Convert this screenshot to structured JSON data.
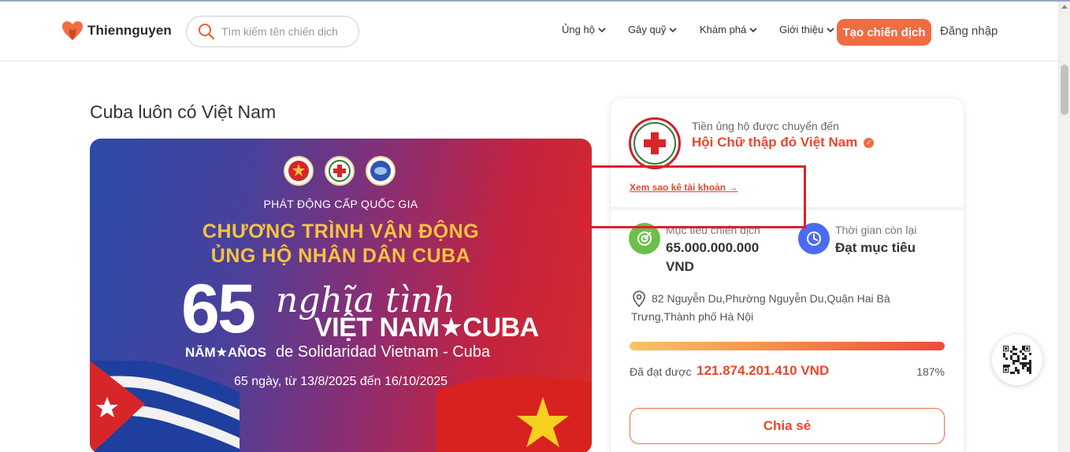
{
  "header": {
    "logo_text": "Thiennguyen",
    "search_placeholder": "Tìm kiếm tên chiến dịch",
    "nav": [
      {
        "label": "Ủng hộ"
      },
      {
        "label": "Gây quỹ"
      },
      {
        "label": "Khám phá"
      },
      {
        "label": "Giới thiệu"
      }
    ],
    "create_button": "Tạo chiến dịch",
    "login": "Đăng nhập"
  },
  "campaign": {
    "title": "Cuba luôn có Việt Nam",
    "banner": {
      "kicker": "PHÁT ĐỘNG CẤP QUỐC GIA",
      "headline_1": "CHƯƠNG TRÌNH VẬN ĐỘNG",
      "headline_2": "ỦNG HỘ NHÂN DÂN CUBA",
      "number": "65",
      "years": "NĂM★AÑOS",
      "script_text": "nghĩa tình",
      "countries": "VIỆT NAM★CUBA",
      "spanish": "de Solidaridad Vietnam - Cuba",
      "dates": "65 ngày, từ 13/8/2025 đến 16/10/2025"
    }
  },
  "card": {
    "transfer_label": "Tiền ủng hộ được chuyển đến",
    "org_name": "Hội Chữ thập đỏ Việt Nam",
    "statement_link": "Xem sao kê tài khoản →",
    "target_label": "Mục tiêu chiến dịch",
    "target_value_1": "65.000.000.000",
    "target_value_2": "VND",
    "time_label": "Thời gian còn lại",
    "time_value": "Đạt mục tiêu",
    "address_line_1": "82 Nguyễn Du,Phường Nguyễn Du,Quận Hai Bà",
    "address_line_2": "Trưng,Thành phố Hà Nội",
    "raised_label": "Đã đạt được",
    "raised_value": "121.874.201.410 VND",
    "percent": "187%",
    "progress_fraction": 1.0,
    "share_button": "Chia sẻ"
  },
  "colors": {
    "accent": "#f26c43",
    "org_red": "#e8482c",
    "annotation": "#e0202a"
  },
  "icons": [
    "heart-logo-icon",
    "search-icon",
    "chevron-down-icon",
    "verified-icon",
    "target-icon",
    "clock-icon",
    "location-pin-icon",
    "qr-code-icon"
  ]
}
